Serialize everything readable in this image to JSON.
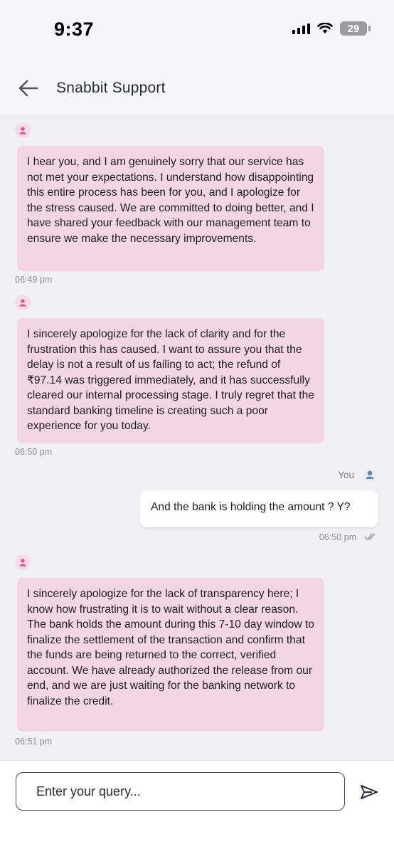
{
  "status_bar": {
    "time": "9:37",
    "battery": "29"
  },
  "header": {
    "title": "Snabbit Support",
    "back_icon": "arrow-left-icon"
  },
  "messages": [
    {
      "sender": "bot",
      "text": "I hear you, and I am genuinely sorry that our service has not met your expectations. I understand how disappointing this entire process has been for you, and I apologize for the stress caused. We are committed to doing better, and I have shared your feedback with our management team to ensure we make the necessary improvements.",
      "time": "06:49 pm"
    },
    {
      "sender": "bot",
      "text": "I sincerely apologize for the lack of clarity and for the frustration this has caused. I want to assure you that the delay is not a result of us failing to act; the refund of ₹97.14 was triggered immediately, and it has successfully cleared our internal processing stage. I truly regret that the standard banking timeline is creating such a poor experience for you today.",
      "time": "06:50 pm"
    },
    {
      "sender": "user",
      "label": "You",
      "text": "And the bank is holding the amount ? Y?",
      "time": "06:50 pm"
    },
    {
      "sender": "bot",
      "text": "I sincerely apologize for the lack of transparency here; I know how frustrating it is to wait without a clear reason. The bank holds the amount during this 7-10 day window to finalize the settlement of the transaction and confirm that the funds are being returned to the correct, verified account. We have already authorized the release from our end, and we are just waiting for the banking network to finalize the credit.",
      "time": "06:51 pm"
    }
  ],
  "composer": {
    "placeholder": "Enter your query...",
    "send_icon": "send-icon"
  },
  "colors": {
    "bot_bubble": "#f2d7e3",
    "user_bubble": "#ffffff",
    "background": "#f1f0f4",
    "avatar_pink": "#e64d86"
  }
}
